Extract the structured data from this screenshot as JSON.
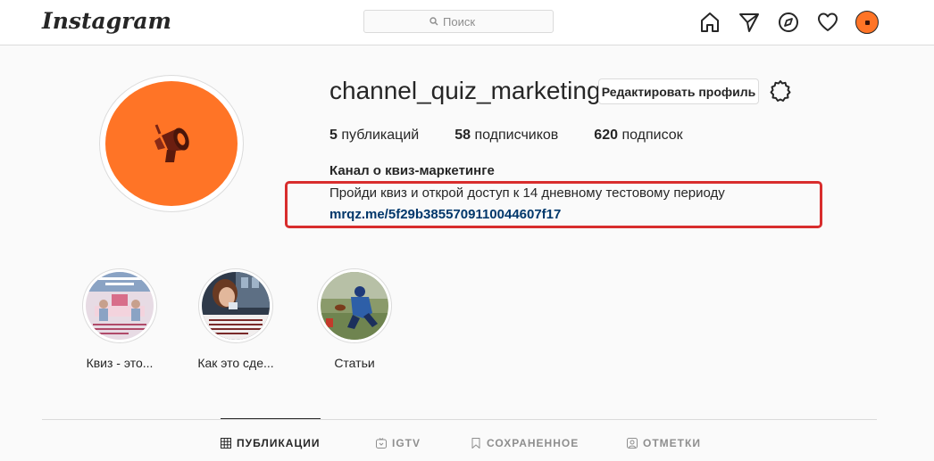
{
  "header": {
    "logo": "Instagram",
    "search_placeholder": "Поиск",
    "icons": [
      "home-icon",
      "direct-icon",
      "explore-icon",
      "activity-heart-icon",
      "profile-avatar"
    ]
  },
  "profile": {
    "username": "channel_quiz_marketing",
    "edit_label": "Редактировать профиль",
    "stats": {
      "posts_count": "5",
      "posts_label": "публикаций",
      "followers_count": "58",
      "followers_label": "подписчиков",
      "following_count": "620",
      "following_label": "подписок"
    },
    "full_name": "Канал о квиз-маркетинге",
    "bio": "Пройди квиз и открой доступ к 14 дневному тестовому периоду",
    "link": "mrqz.me/5f29b3855709110044607f17"
  },
  "highlights": [
    {
      "label": "Квиз - это..."
    },
    {
      "label": "Как это сде..."
    },
    {
      "label": "Статьи"
    }
  ],
  "tabs": [
    {
      "label": "ПУБЛИКАЦИИ",
      "icon": "grid-icon",
      "active": true
    },
    {
      "label": "IGTV",
      "icon": "igtv-icon",
      "active": false
    },
    {
      "label": "СОХРАНЕННОЕ",
      "icon": "bookmark-icon",
      "active": false
    },
    {
      "label": "ОТМЕТКИ",
      "icon": "tagged-icon",
      "active": false
    }
  ],
  "colors": {
    "accent_orange": "#ff7426",
    "link_blue": "#00376b",
    "highlight_red": "#d82d2d"
  }
}
